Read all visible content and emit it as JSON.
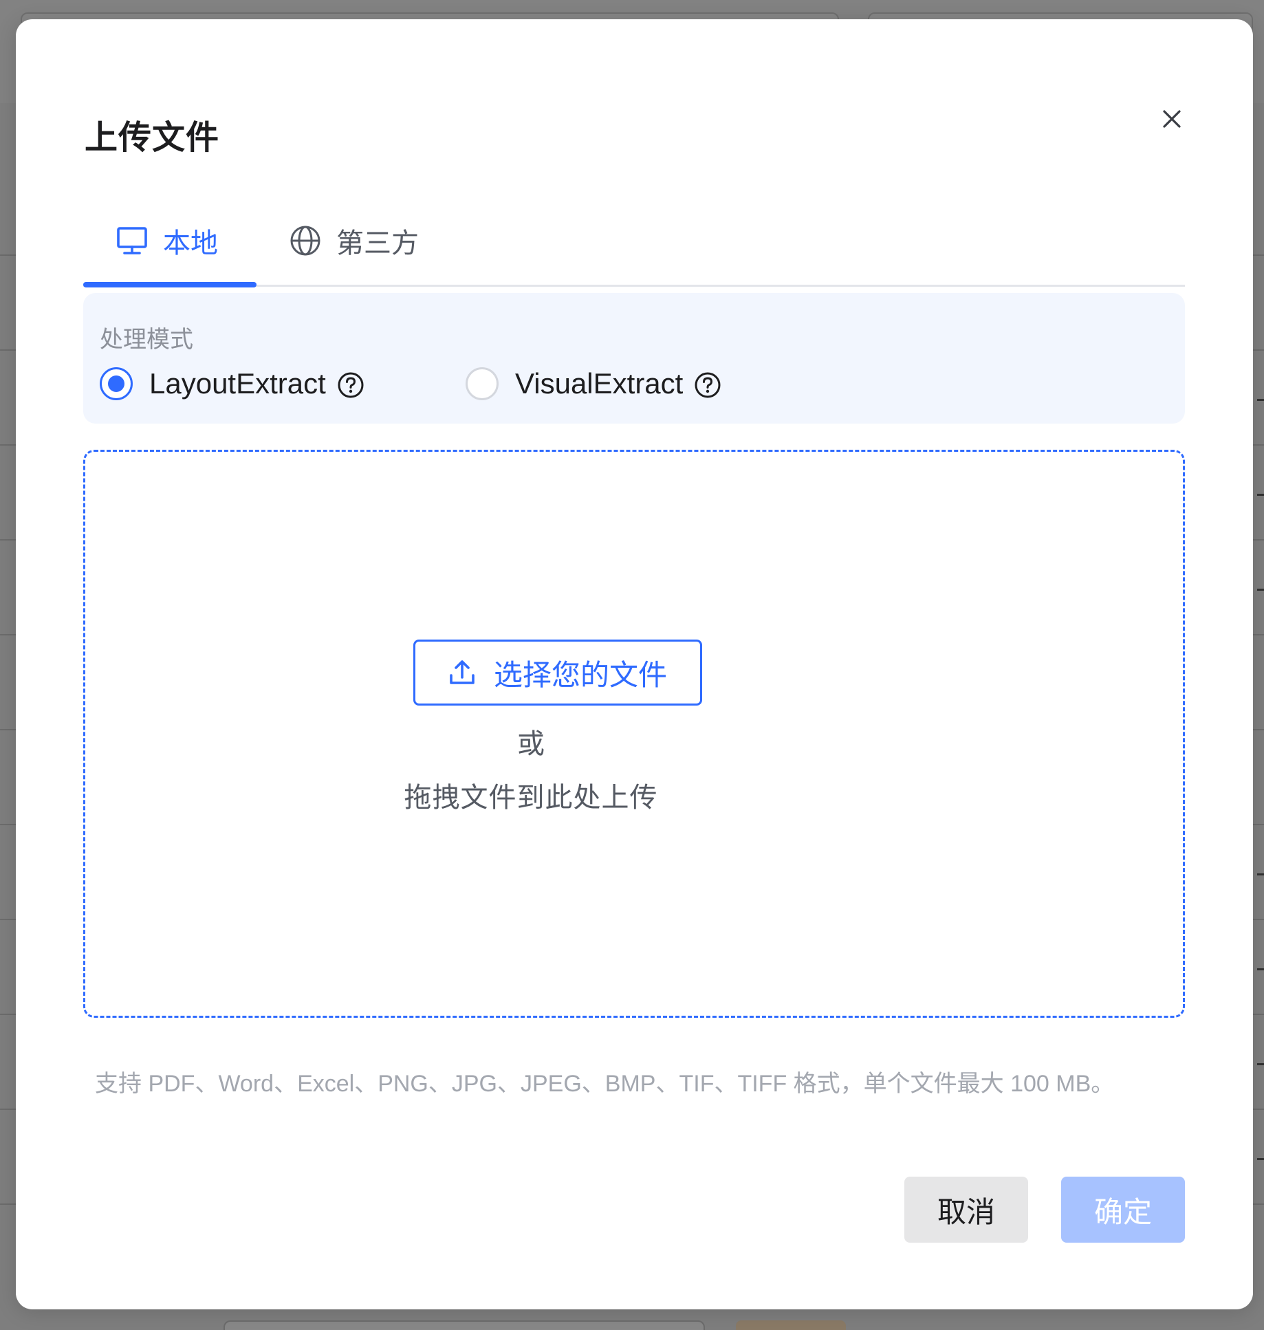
{
  "dialog": {
    "title": "上传文件",
    "close_icon": "close-icon"
  },
  "tabs": [
    {
      "label": "本地",
      "icon": "desktop-monitor-icon",
      "active": true
    },
    {
      "label": "第三方",
      "icon": "globe-icon",
      "active": false
    }
  ],
  "mode": {
    "label": "处理模式",
    "options": [
      {
        "label": "LayoutExtract",
        "selected": true,
        "help_icon": "question-circle-icon"
      },
      {
        "label": "VisualExtract",
        "selected": false,
        "help_icon": "question-circle-icon"
      }
    ]
  },
  "dropzone": {
    "choose_button_label": "选择您的文件",
    "choose_button_icon": "upload-icon",
    "or_text": "或",
    "drag_text": "拖拽文件到此处上传"
  },
  "support_text": "支持 PDF、Word、Excel、PNG、JPG、JPEG、BMP、TIF、TIFF 格式，单个文件最大 100 MB。",
  "footer": {
    "cancel_label": "取消",
    "ok_label": "确定"
  },
  "colors": {
    "accent": "#2f6bff",
    "ok_disabled": "#a7c2ff",
    "panel_bg": "#f2f6fe"
  }
}
